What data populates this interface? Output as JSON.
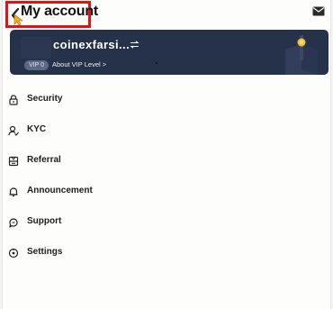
{
  "header": {
    "title": "My account"
  },
  "account": {
    "username": "coinexfarsi...",
    "vip_badge": "VIP 0",
    "vip_link": "About VIP Level >"
  },
  "menu": {
    "items": [
      {
        "label": "Security",
        "icon": "lock-icon"
      },
      {
        "label": "KYC",
        "icon": "user-check-icon"
      },
      {
        "label": "Referral",
        "icon": "referral-icon"
      },
      {
        "label": "Announcement",
        "icon": "bell-icon"
      },
      {
        "label": "Support",
        "icon": "support-icon"
      },
      {
        "label": "Settings",
        "icon": "settings-icon"
      }
    ]
  },
  "colors": {
    "card_background": "#26314a",
    "highlight_border": "#e01414",
    "vip_gold": "#f0c332"
  }
}
